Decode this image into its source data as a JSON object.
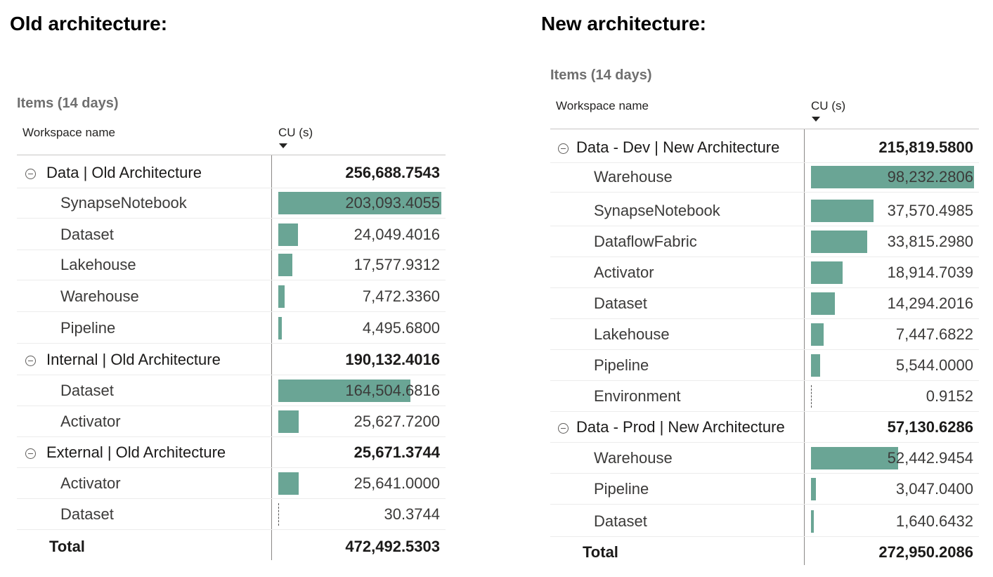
{
  "headings": {
    "old": "Old architecture:",
    "new": "New architecture:"
  },
  "colors": {
    "bar": "#6aa595"
  },
  "panels": [
    {
      "id": "old",
      "title": "Items (14 days)",
      "col_workspace": "Workspace name",
      "col_cu": "CU (s)",
      "scale_max": 203093.4055,
      "rows": [
        {
          "kind": "group",
          "label": "Data | Old Architecture",
          "value": "256,688.7543"
        },
        {
          "kind": "item",
          "label": "SynapseNotebook",
          "value": "203,093.4055",
          "num": 203093.4055
        },
        {
          "kind": "item",
          "label": "Dataset",
          "value": "24,049.4016",
          "num": 24049.4016
        },
        {
          "kind": "item",
          "label": "Lakehouse",
          "value": "17,577.9312",
          "num": 17577.9312
        },
        {
          "kind": "item",
          "label": "Warehouse",
          "value": "7,472.3360",
          "num": 7472.336
        },
        {
          "kind": "item",
          "label": "Pipeline",
          "value": "4,495.6800",
          "num": 4495.68
        },
        {
          "kind": "group",
          "label": "Internal | Old Architecture",
          "value": "190,132.4016"
        },
        {
          "kind": "item",
          "label": "Dataset",
          "value": "164,504.6816",
          "num": 164504.6816
        },
        {
          "kind": "item",
          "label": "Activator",
          "value": "25,627.7200",
          "num": 25627.72
        },
        {
          "kind": "group",
          "label": "External | Old Architecture",
          "value": "25,671.3744"
        },
        {
          "kind": "item",
          "label": "Activator",
          "value": "25,641.0000",
          "num": 25641.0
        },
        {
          "kind": "item",
          "label": "Dataset",
          "value": "30.3744",
          "num": 30.3744
        },
        {
          "kind": "total",
          "label": "Total",
          "value": "472,492.5303"
        }
      ]
    },
    {
      "id": "new",
      "title": "Items (14 days)",
      "col_workspace": "Workspace name",
      "col_cu": "CU (s)",
      "scale_max": 98232.2806,
      "rows": [
        {
          "kind": "group",
          "label": "Data - Dev | New Architecture",
          "value": "215,819.5800"
        },
        {
          "kind": "item",
          "label": "Warehouse",
          "value": "98,232.2806",
          "num": 98232.2806
        },
        {
          "kind": "item",
          "label": "SynapseNotebook",
          "value": "37,570.4985",
          "num": 37570.4985
        },
        {
          "kind": "item",
          "label": "DataflowFabric",
          "value": "33,815.2980",
          "num": 33815.298
        },
        {
          "kind": "item",
          "label": "Activator",
          "value": "18,914.7039",
          "num": 18914.7039
        },
        {
          "kind": "item",
          "label": "Dataset",
          "value": "14,294.2016",
          "num": 14294.2016
        },
        {
          "kind": "item",
          "label": "Lakehouse",
          "value": "7,447.6822",
          "num": 7447.6822
        },
        {
          "kind": "item",
          "label": "Pipeline",
          "value": "5,544.0000",
          "num": 5544.0
        },
        {
          "kind": "item",
          "label": "Environment",
          "value": "0.9152",
          "num": 0.9152
        },
        {
          "kind": "group",
          "label": "Data - Prod | New Architecture",
          "value": "57,130.6286"
        },
        {
          "kind": "item",
          "label": "Warehouse",
          "value": "52,442.9454",
          "num": 52442.9454
        },
        {
          "kind": "item",
          "label": "Pipeline",
          "value": "3,047.0400",
          "num": 3047.04
        },
        {
          "kind": "item",
          "label": "Dataset",
          "value": "1,640.6432",
          "num": 1640.6432
        },
        {
          "kind": "total",
          "label": "Total",
          "value": "272,950.2086"
        }
      ]
    }
  ]
}
